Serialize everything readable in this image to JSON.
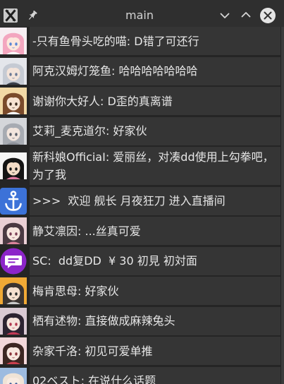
{
  "window": {
    "title": "main",
    "icons": [
      "app-icon",
      "pin-icon",
      "chevron-down-icon",
      "chevron-up-icon",
      "close-icon"
    ]
  },
  "theme": {
    "background": "#252525",
    "titlebar": "#2f2f2f",
    "row": "#353535",
    "text": "#e6e6e6",
    "title_text": "#d2d2d2",
    "icon": "#d6d6d6",
    "close_circle": "#e4e4e4",
    "scrollbar": "#3b3b3b"
  },
  "messages": [
    {
      "text": "-只有鱼骨头吃的喵: D错了可还行",
      "avatar": {
        "icon": "anime-avatar",
        "bg": "#f7eef2",
        "hair": "#f3a6bf",
        "skin": "#fde7dc",
        "eyes": "#5a86d6",
        "accent": "#ffffff"
      }
    },
    {
      "text": "阿克汉姆灯笼鱼: 哈哈哈哈哈哈哈",
      "avatar": {
        "icon": "anime-avatar",
        "bg": "#e4e6eb",
        "hair": "#c5cad3",
        "skin": "#f4e4da",
        "eyes": "#6b7a96",
        "accent": "#3a3f4a"
      }
    },
    {
      "text": "谢谢你大好人: D歪的真离谱",
      "avatar": {
        "icon": "anime-avatar",
        "bg": "#f2d9a6",
        "hair": "#7a4a2b",
        "skin": "#f7e3d2",
        "eyes": "#3b2a1e",
        "accent": "#ffffff"
      }
    },
    {
      "text": "艾莉_麦克道尔: 好家伙",
      "avatar": {
        "icon": "anime-avatar",
        "bg": "#d4d6da",
        "hair": "#a7abb2",
        "skin": "#f2e5dd",
        "eyes": "#5a5f6a",
        "accent": "#8d9199"
      }
    },
    {
      "text": "新科娘OfficiaI: 爱丽丝，对凑dd使用上勾拳吧，为了我",
      "avatar": {
        "icon": "anime-avatar",
        "bg": "#f5f5f5",
        "hair": "#141414",
        "skin": "#f3dcc6",
        "eyes": "#141414",
        "accent": "#e07aa0"
      }
    },
    {
      "text": ">>>  欢迎 舰长 月夜狂刀 进入直播间",
      "avatar": {
        "icon": "anchor-icon",
        "bg": "#3c72d8",
        "fg": "#ffffff"
      }
    },
    {
      "text": "静艾凛因: ...丝真可爱",
      "avatar": {
        "icon": "anime-avatar",
        "bg": "#ead0d5",
        "hair": "#4b3a42",
        "skin": "#f7e6df",
        "eyes": "#7a3d55",
        "accent": "#d9829a"
      }
    },
    {
      "text": "SC:  dd复DD  ¥ 30 初見 初対面",
      "avatar": {
        "icon": "chat-bubble-icon",
        "bg": "#8c25c9",
        "fg": "#ffffff"
      }
    },
    {
      "text": "梅肯思母: 好家伙",
      "avatar": {
        "icon": "anime-avatar",
        "bg": "#f0a935",
        "hair": "#3b3431",
        "skin": "#f5e0cf",
        "eyes": "#2b2b2b",
        "accent": "#c9c9c9"
      }
    },
    {
      "text": "栖有述物: 直接做成麻辣兔头",
      "avatar": {
        "icon": "anime-avatar",
        "bg": "#d9c9d3",
        "hair": "#2c2331",
        "skin": "#f6e4dc",
        "eyes": "#b2344e",
        "accent": "#c23a56"
      }
    },
    {
      "text": "杂家千洛: 初见可爱单推",
      "avatar": {
        "icon": "anime-avatar",
        "bg": "#f2d7da",
        "hair": "#3c2622",
        "skin": "#f8e7df",
        "eyes": "#8a2f38",
        "accent": "#c9404e"
      }
    },
    {
      "text": "02ベスト: 在说什么话题",
      "avatar": {
        "icon": "anime-avatar",
        "bg": "#9dbbe0",
        "hair": "#efe3d6",
        "skin": "#f8ebe2",
        "eyes": "#3a5c9a",
        "accent": "#ffffff"
      }
    }
  ]
}
